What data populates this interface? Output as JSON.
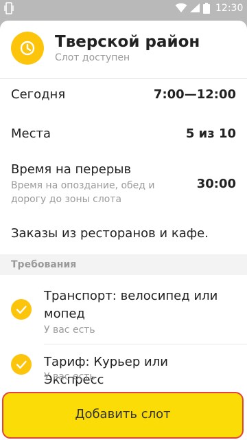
{
  "status_bar": {
    "time": "12:30",
    "icons": [
      "vibrate-icon",
      "wifi-icon",
      "signal-icon",
      "battery-icon"
    ]
  },
  "header": {
    "icon": "clock-icon",
    "title": "Тверской район",
    "subtitle": "Слот доступен"
  },
  "rows": {
    "today": {
      "label": "Сегодня",
      "value": "7:00—12:00"
    },
    "places": {
      "label": "Места",
      "value": "5 из 10"
    },
    "break": {
      "label": "Время на перерыв",
      "sublabel": "Время на опоздание, обед и дорогу до зоны слота",
      "value": "30:00"
    },
    "orders": {
      "text": "Заказы из ресторанов и кафе."
    }
  },
  "requirements": {
    "title": "Требования",
    "items": [
      {
        "title": "Транспорт: велосипед или мопед",
        "status": "У вас есть"
      },
      {
        "title": "Тариф: Курьер или Экспресс",
        "status": "У вас есть"
      }
    ]
  },
  "add_button": {
    "label": "Добавить слот"
  },
  "colors": {
    "accent_yellow": "#fcc40a",
    "button_yellow": "#fbdc06",
    "highlight_border": "#e0443b"
  }
}
